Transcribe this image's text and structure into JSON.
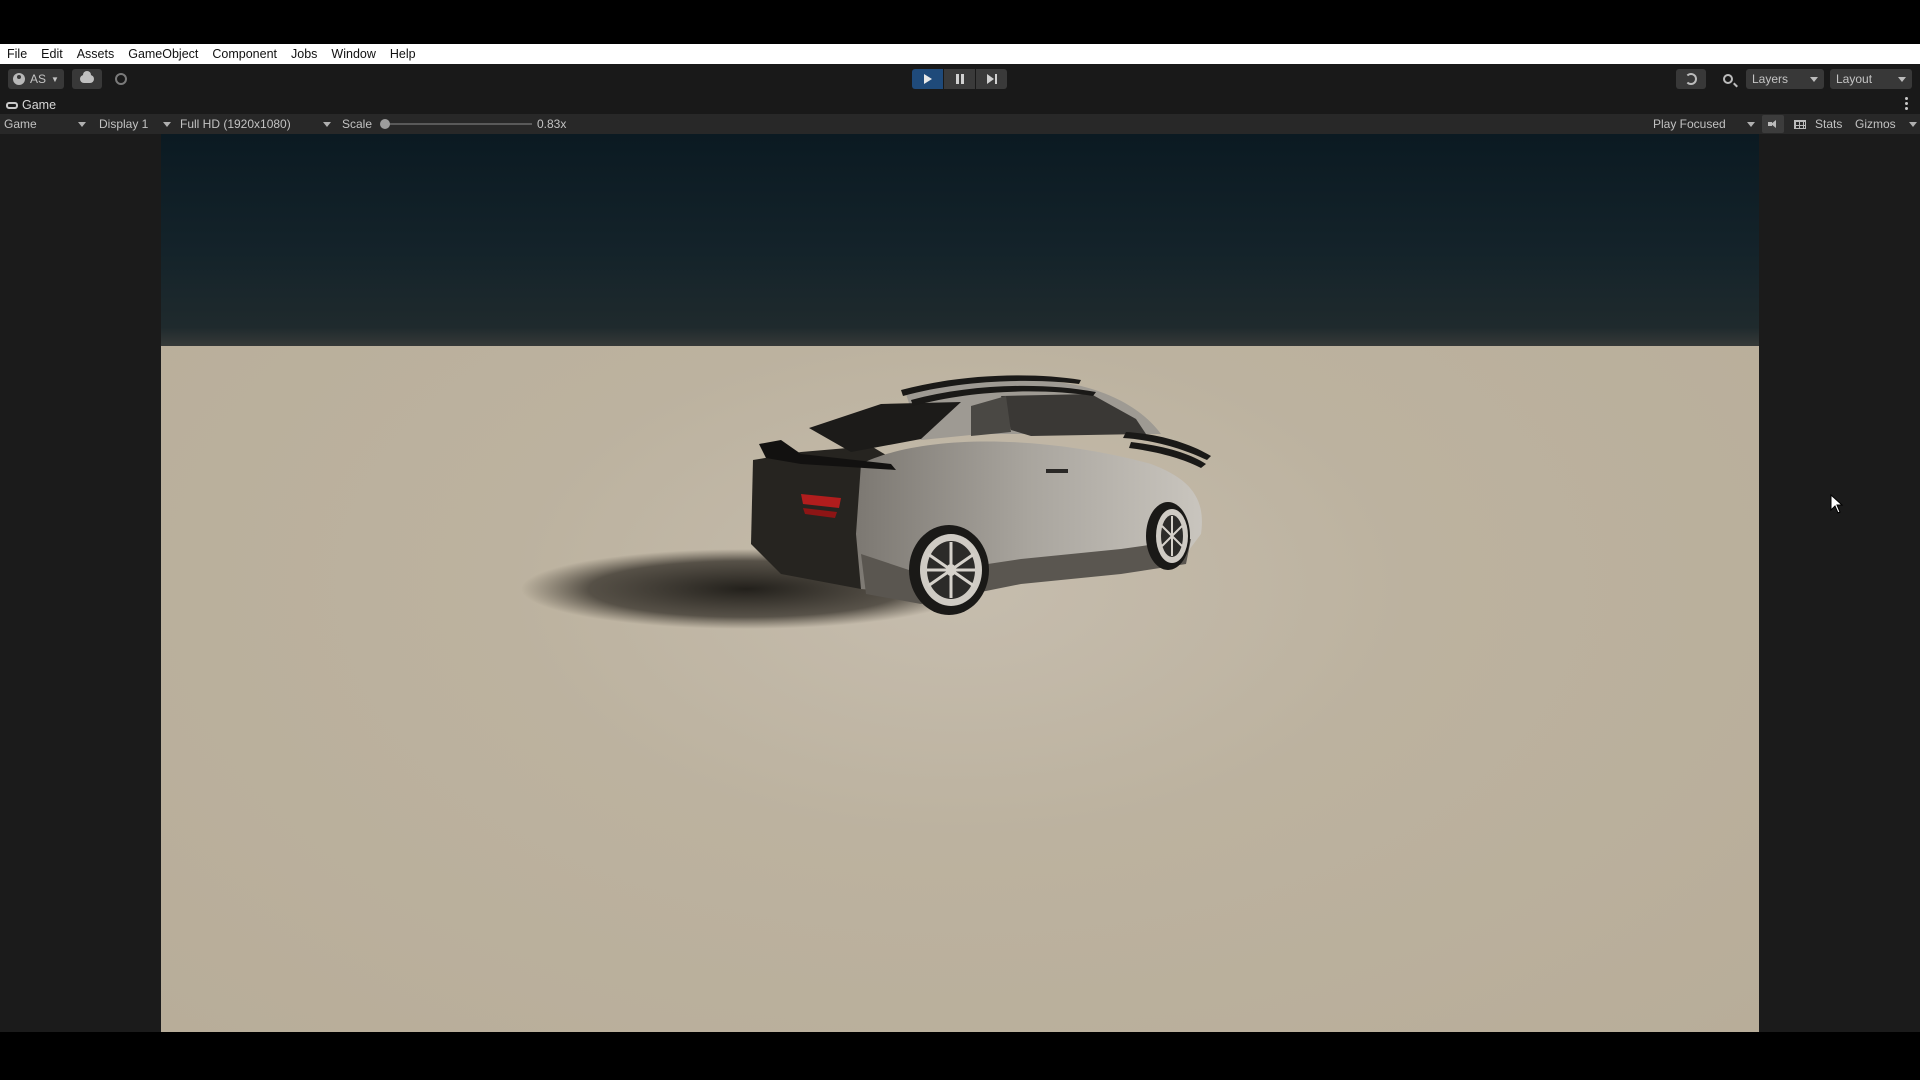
{
  "menu": {
    "items": [
      "File",
      "Edit",
      "Assets",
      "GameObject",
      "Component",
      "Jobs",
      "Window",
      "Help"
    ]
  },
  "toolbar": {
    "account_label": "AS",
    "layers_label": "Layers",
    "layout_label": "Layout",
    "play_active": true
  },
  "tab": {
    "title": "Game"
  },
  "gamebar": {
    "mode_label": "Game",
    "display_label": "Display 1",
    "resolution_label": "Full HD (1920x1080)",
    "scale_label": "Scale",
    "scale_value": "0.83x",
    "play_mode_label": "Play Focused",
    "stats_label": "Stats",
    "gizmos_label": "Gizmos"
  },
  "colors": {
    "play_active": "#1f4a7a",
    "toolbar_bg": "#191919",
    "gamebar_bg": "#282828",
    "menubar_bg": "#ffffff",
    "ground": "#bcb29f",
    "sky": "#0b1a22"
  }
}
